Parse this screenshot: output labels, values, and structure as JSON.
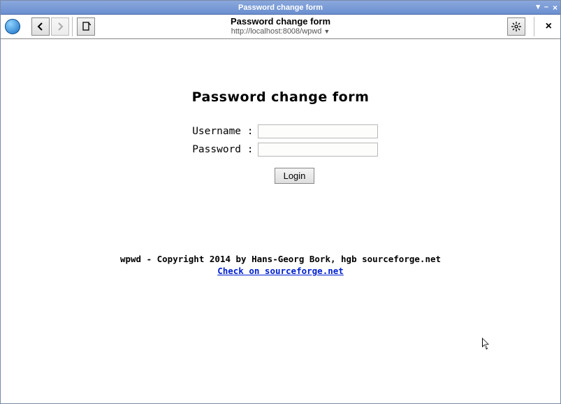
{
  "window": {
    "title": "Password change form",
    "controls": {
      "pin": "▾",
      "min": "–",
      "close": "×"
    }
  },
  "toolbar": {
    "page_title": "Password change form",
    "url": "http://localhost:8008/wpwd",
    "back": "‹",
    "forward": "›",
    "bookmark": "⎘",
    "settings": "✻",
    "close_tab": "×"
  },
  "page": {
    "heading": "Password change form",
    "username_label": "Username :",
    "password_label": "Password :",
    "username_value": "",
    "password_value": "",
    "login_label": "Login"
  },
  "footer": {
    "copyright": "wpwd - Copyright 2014 by Hans-Georg Bork, hgb sourceforge.net",
    "link_text": "Check on sourceforge.net"
  }
}
